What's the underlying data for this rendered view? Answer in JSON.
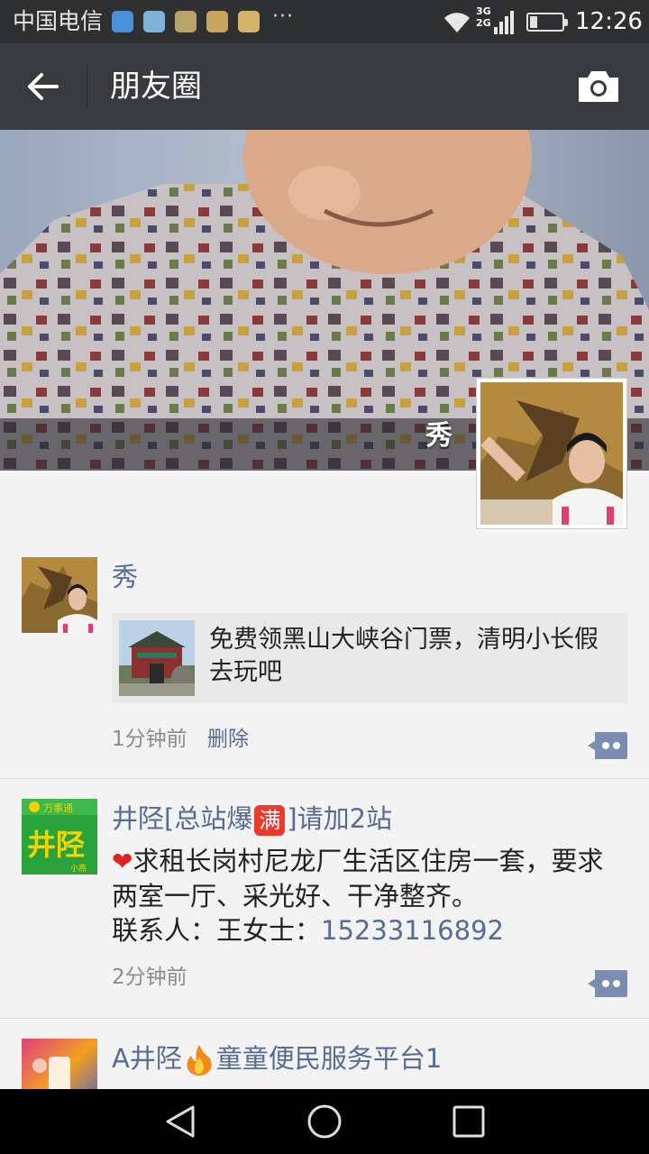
{
  "status_bar": {
    "carrier": "中国电信",
    "network": [
      "3G",
      "2G"
    ],
    "time": "12:26",
    "more": "···",
    "battery_level": 0.15,
    "icons": [
      "sogou-icon",
      "browser-icon",
      "app-icon-1",
      "app-icon-2",
      "chat-icon"
    ]
  },
  "title_bar": {
    "title": "朋友圈",
    "back_icon": "arrow-left-icon",
    "camera_icon": "camera-icon"
  },
  "cover": {
    "owner_name": "秀"
  },
  "posts": [
    {
      "nickname": "秀",
      "link_card": {
        "title": "免费领黑山大峡谷门票，清明小长假去玩吧"
      },
      "time": "1分钟前",
      "delete_label": "删除"
    },
    {
      "nickname_prefix": "井陉[总站爆",
      "nickname_badge": "满",
      "nickname_suffix": "]请加2站",
      "content_line1": "求租长岗村尼龙厂生活区住房一套，要求两室一厅、采光好、干净整齐。",
      "contact_label": "联系人：王女士：",
      "phone": "15233116892",
      "time": "2分钟前",
      "avatar_text": "井陉",
      "avatar_top_text": "万事通",
      "avatar_sub_text": "小燕"
    },
    {
      "nickname_prefix": "A井陉",
      "nickname_suffix": "童童便民服务平台1"
    }
  ],
  "colors": {
    "status_bar": "#2e3032",
    "title_bar": "#393a3f",
    "link_blue": "#576b95",
    "feed_bg": "#f3f3f3"
  }
}
